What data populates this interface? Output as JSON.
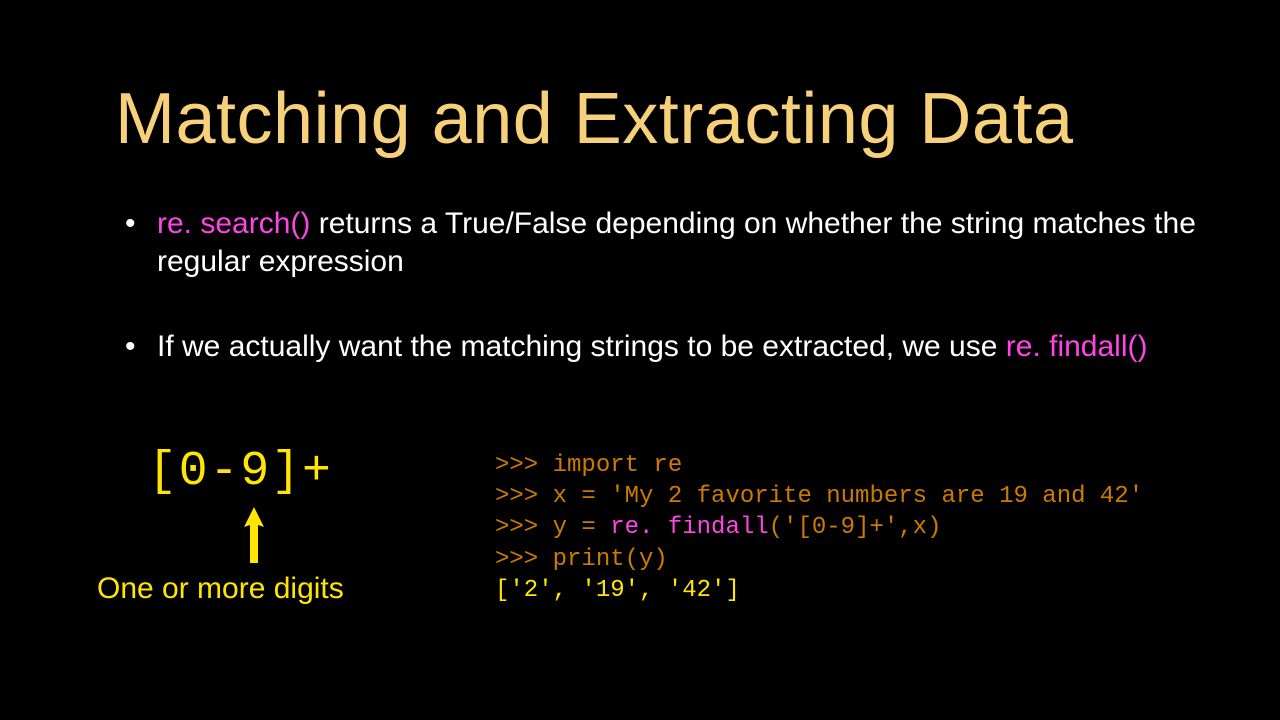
{
  "title": "Matching and Extracting Data",
  "bullets": {
    "b1": {
      "hl": "re. search()",
      "rest": " returns a True/False depending on whether the string matches  the regular expression"
    },
    "b2": {
      "pre": "If we actually want the matching strings to be extracted, we use ",
      "hl": "re. findall()"
    }
  },
  "regex": "[0-9]+",
  "caption": "One or more digits",
  "code": {
    "p": ">>> ",
    "l1": "import re",
    "l2": "x = 'My 2 favorite numbers are 19 and 42'",
    "l3a": "y = ",
    "l3b": "re. findall",
    "l3c": "('[0-9]+',x)",
    "l4": "print(y)",
    "out": "['2', '19', '42']"
  }
}
